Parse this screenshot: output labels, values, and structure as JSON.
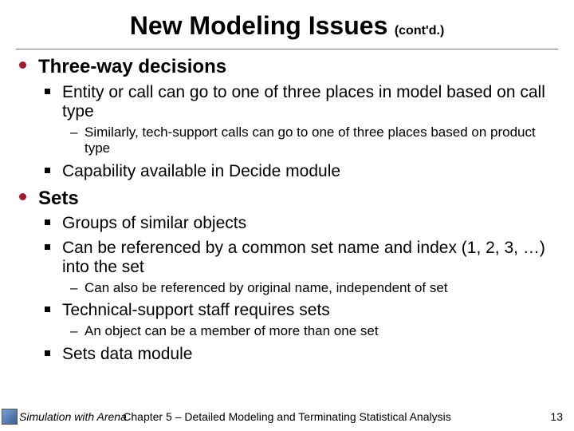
{
  "title": "New  Modeling Issues",
  "title_suffix": "(cont'd.)",
  "sections": [
    {
      "heading": "Three-way decisions",
      "items": [
        {
          "text": "Entity or call can go to one of three places in model based on call type",
          "sub": [
            "Similarly, tech-support calls can go to one of three places based on product type"
          ]
        },
        {
          "text": "Capability available in Decide module",
          "sub": []
        }
      ]
    },
    {
      "heading": "Sets",
      "items": [
        {
          "text": "Groups of similar objects",
          "sub": []
        },
        {
          "text": "Can be referenced by a common set name and index (1, 2, 3, …) into the set",
          "sub": [
            "Can also be referenced by original name, independent of set"
          ]
        },
        {
          "text": "Technical-support staff requires sets",
          "sub": [
            "An object can be a member of more than one set"
          ]
        },
        {
          "text": "Sets data module",
          "sub": []
        }
      ]
    }
  ],
  "footer": {
    "left": "Simulation with Arena",
    "center": "Chapter 5 – Detailed Modeling and Terminating Statistical Analysis",
    "page": "13"
  }
}
